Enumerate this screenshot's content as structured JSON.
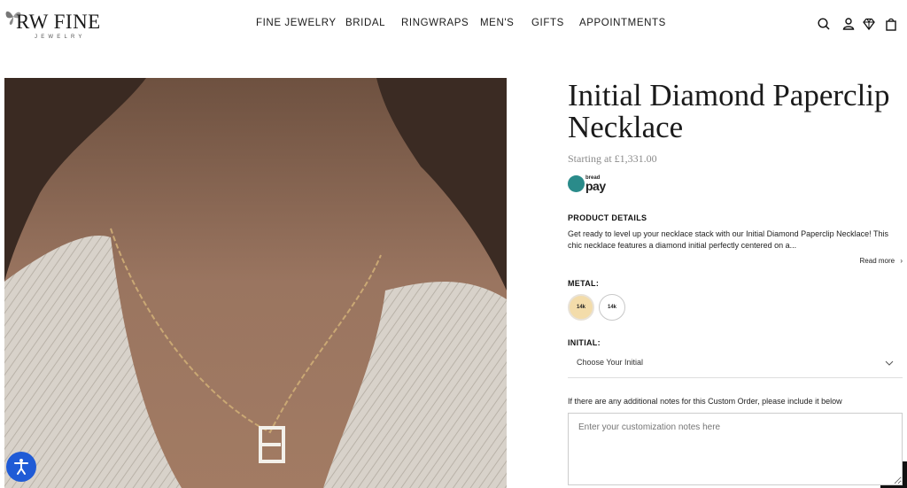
{
  "header": {
    "logo_main": "RW FINE",
    "logo_sub": "JEWELRY",
    "nav": [
      {
        "label": "FINE JEWELRY"
      },
      {
        "label": "BRIDAL"
      },
      {
        "label": "RINGWRAPS"
      },
      {
        "label": "MEN'S"
      },
      {
        "label": "GIFTS"
      },
      {
        "label": "APPOINTMENTS"
      }
    ],
    "icons": [
      "search-icon",
      "account-icon",
      "diamond-icon",
      "bag-icon"
    ]
  },
  "product": {
    "title": "Initial Diamond Paperclip Necklace",
    "price": "Starting at £1,331.00",
    "bread_small": "bread",
    "bread_big": "pay",
    "details_heading": "PRODUCT DETAILS",
    "description": "Get ready to level up your necklace stack with our Initial Diamond Paperclip Necklace! This chic necklace features a diamond initial perfectly centered on a...",
    "read_more": "Read more",
    "metal_heading": "METAL:",
    "metal_options": [
      {
        "label": "14k",
        "color": "#f3dcaa",
        "selected": true
      },
      {
        "label": "14k",
        "color": "#ffffff",
        "selected": false
      }
    ],
    "initial_heading": "INITIAL:",
    "initial_value": "Choose Your Initial",
    "notes_label": "If there are any additional notes for this Custom Order, please include it below",
    "notes_placeholder": "Enter your customization notes here"
  },
  "colors": {
    "accent_accessibility": "#1f5bd6",
    "gold_swatch": "#f3dcaa",
    "bread_teal": "#2a8b8a"
  }
}
